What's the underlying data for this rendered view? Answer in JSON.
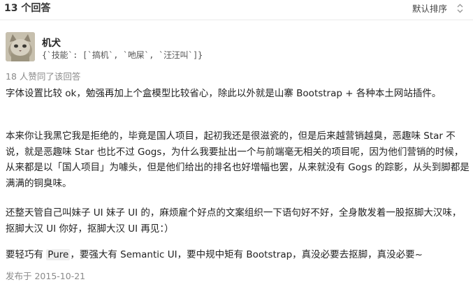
{
  "header": {
    "answer_count": "13 个回答",
    "sort_label": "默认排序"
  },
  "author": {
    "name": "机犬",
    "bio": "{`技能`: [`搞机`, `吔屎`, `汪汪叫`]}"
  },
  "votes": "18 人赞同了该回答",
  "content": {
    "p1": "字体设置比较 ok，勉强再加上个盒模型比较省心，除此以外就是山寨 Bootstrap + 各种本土网站插件。",
    "p2": "本来你让我黑它我是拒绝的，毕竟是国人项目，起初我还是很滋瓷的，但是后来越营销越臭，恶趣味 Star 不说，就是恶趣味 Star 也比不过 Gogs，为什么我要扯出一个与前端毫无相关的项目呢，因为他们营销的时候，从来都是以「国人项目」为噱头，但是他们给出的排名也好增幅也罢，从来就没有 Gogs 的踪影，从头到脚都是满满的铜臭味。",
    "p3": "还整天管自己叫妹子 UI 妹子 UI 的，麻烦雇个好点的文案组织一下语句好不好，全身散发着一股抠脚大汉味，抠脚大汉 UI 你好，抠脚大汉 UI 再见：）",
    "p4_before": "要轻巧有 ",
    "p4_highlight": "Pure",
    "p4_after": "，要强大有 Semantic UI，要中规中矩有 Bootstrap，真没必要去抠脚，真没必要~"
  },
  "published": "发布于 2015-10-21"
}
